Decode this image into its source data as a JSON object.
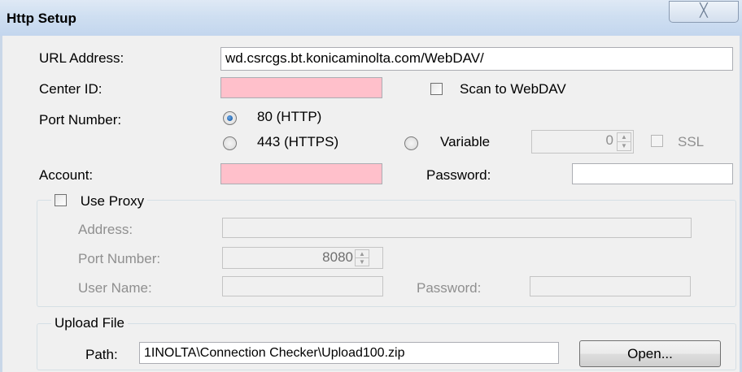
{
  "window": {
    "title": "Http Setup",
    "close_glyph": "╳"
  },
  "url": {
    "label": "URL Address:",
    "value": "wd.csrcgs.bt.konicaminolta.com/WebDAV/"
  },
  "center_id": {
    "label": "Center ID:",
    "value": ""
  },
  "scan_to_webdav": {
    "label": "Scan to WebDAV",
    "checked": false
  },
  "port": {
    "label": "Port Number:",
    "option_80": "80 (HTTP)",
    "option_443": "443 (HTTPS)",
    "option_variable": "Variable",
    "selected": "80 (HTTP)",
    "variable_value": "0",
    "ssl_label": "SSL"
  },
  "account": {
    "label": "Account:",
    "value": "",
    "password_label": "Password:",
    "password_value": ""
  },
  "proxy": {
    "label": "Use Proxy",
    "checked": false,
    "address_label": "Address:",
    "address_value": "",
    "port_label": "Port Number:",
    "port_value": "8080",
    "user_label": "User Name:",
    "user_value": "",
    "password_label": "Password:",
    "password_value": ""
  },
  "upload": {
    "label": "Upload File",
    "path_label": "Path:",
    "path_value": "1INOLTA\\Connection Checker\\Upload100.zip",
    "open_label": "Open..."
  },
  "colors": {
    "required_field": "#ffc0cb",
    "title_bar": "#cfdff1",
    "dialog_bg": "#f0f0f0"
  }
}
